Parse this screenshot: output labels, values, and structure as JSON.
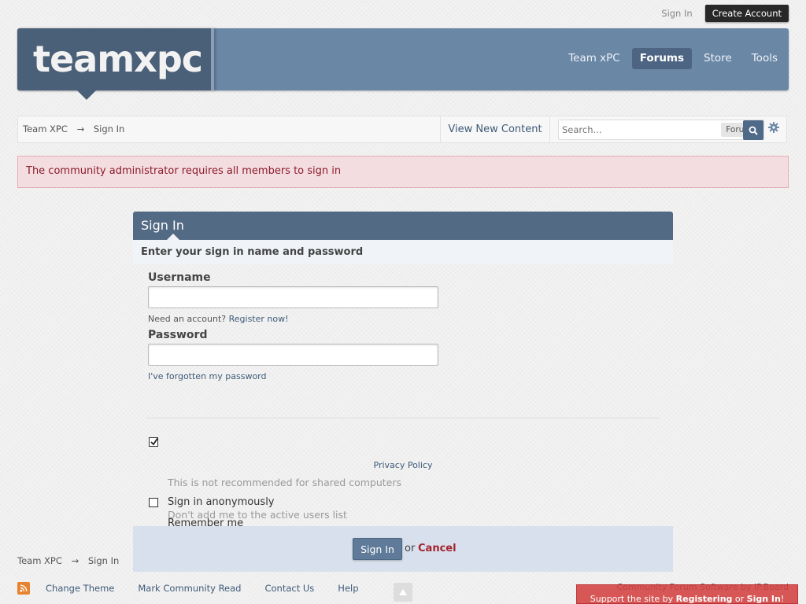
{
  "userbar": {
    "sign_in": "Sign In",
    "create_account": "Create Account"
  },
  "header": {
    "logo_text": "teamxpc",
    "nav": [
      {
        "label": "Team xPC",
        "active": false
      },
      {
        "label": "Forums",
        "active": true
      },
      {
        "label": "Store",
        "active": false
      },
      {
        "label": "Tools",
        "active": false
      }
    ]
  },
  "breadcrumb": {
    "home": "Team XPC",
    "separator": "→",
    "current": "Sign In"
  },
  "view_new_content": "View New Content",
  "search": {
    "placeholder": "Search...",
    "scope": "Forums"
  },
  "alert": "The community administrator requires all members to sign in",
  "signin": {
    "title": "Sign In",
    "subtitle": "Enter your sign in name and password",
    "username_label": "Username",
    "need_account": "Need an account?",
    "register": "Register now!",
    "password_label": "Password",
    "forgot": "I've forgotten my password",
    "remember_label": "Remember me",
    "remember_desc": "This is not recommended for shared computers",
    "remember_checked": true,
    "anon_label": "Sign in anonymously",
    "anon_desc": "Don't add me to the active users list",
    "anon_checked": false,
    "privacy": "Privacy Policy",
    "submit": "Sign In",
    "or": "or",
    "cancel": "Cancel"
  },
  "footer": {
    "crumb_home": "Team XPC",
    "crumb_sep": "→",
    "crumb_current": "Sign In",
    "links": [
      "Change Theme",
      "Mark Community Read",
      "Contact Us",
      "Help"
    ],
    "powered": "Community Forum Software by IP.Board",
    "support_prefix": "Support the site by ",
    "support_register": "Registering",
    "support_or": " or ",
    "support_signin": "Sign In",
    "support_suffix": "!"
  },
  "colors": {
    "header_bg": "#6a87a6",
    "logo_bg": "#4a5f78",
    "alert_bg": "#f3dde1",
    "alert_text": "#8c1c2a",
    "panel_head": "#536a84",
    "cancel": "#a3232f"
  }
}
